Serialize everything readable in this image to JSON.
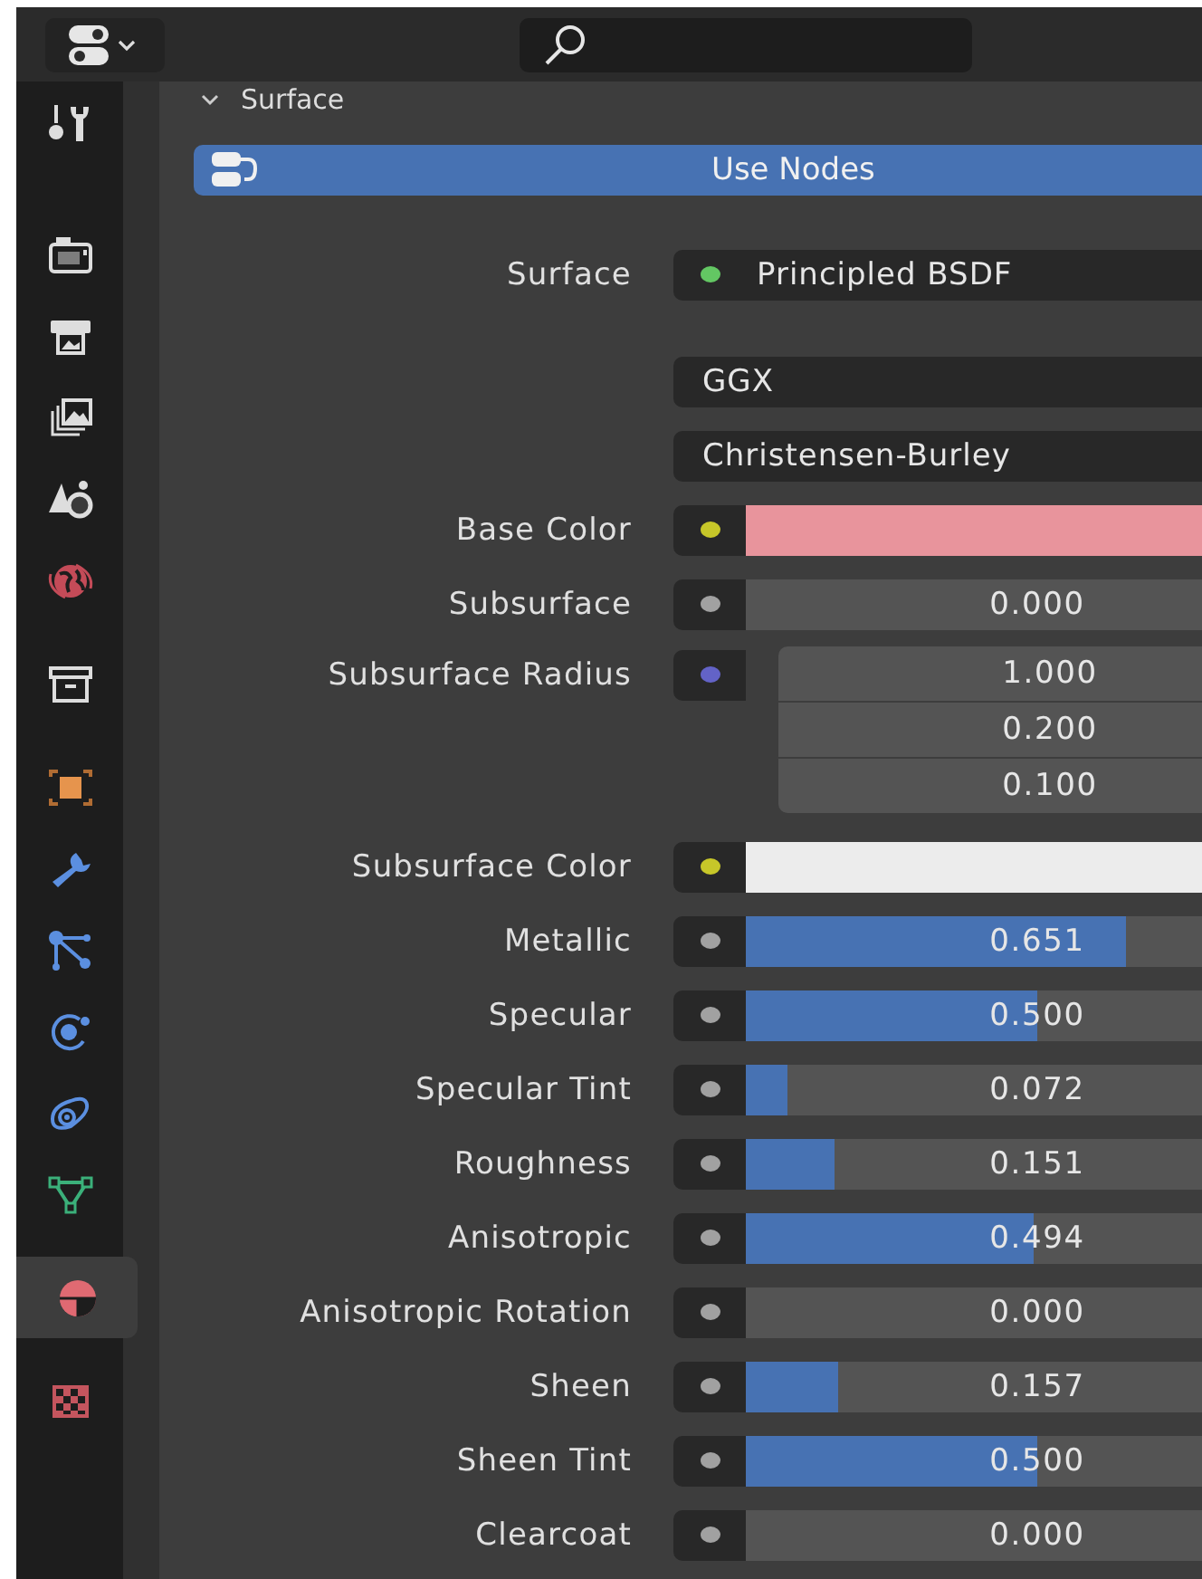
{
  "sidebar": {
    "groups": [
      {
        "tabs": [
          {
            "kind": "tool",
            "selected": false
          }
        ]
      },
      {
        "tabs": [
          {
            "kind": "render",
            "selected": false
          },
          {
            "kind": "output",
            "selected": false
          },
          {
            "kind": "view-layer",
            "selected": false
          },
          {
            "kind": "scene",
            "selected": false
          },
          {
            "kind": "world",
            "selected": false
          }
        ]
      },
      {
        "tabs": [
          {
            "kind": "collection",
            "selected": false
          }
        ]
      },
      {
        "tabs": [
          {
            "kind": "object",
            "selected": false
          },
          {
            "kind": "modifier",
            "selected": false
          },
          {
            "kind": "particles",
            "selected": false
          },
          {
            "kind": "physics",
            "selected": false
          },
          {
            "kind": "constraints",
            "selected": false
          },
          {
            "kind": "data",
            "selected": false
          }
        ]
      },
      {
        "tabs": [
          {
            "kind": "material",
            "selected": true
          }
        ]
      },
      {
        "tabs": [
          {
            "kind": "texture",
            "selected": false
          }
        ]
      }
    ]
  },
  "panel": {
    "title": "Surface",
    "expanded": true,
    "use_nodes": {
      "label": "Use Nodes",
      "on": true
    },
    "rows": [
      {
        "kind": "shader",
        "label": "Surface",
        "color": "#63c763",
        "value": "Principled BSDF"
      },
      {
        "kind": "dropdown",
        "value": "GGX"
      },
      {
        "kind": "dropdown",
        "value": "Christensen-Burley"
      },
      {
        "kind": "color",
        "label": "Base Color",
        "color": "#c7c729",
        "swatch": {
          "color": "#e8949c"
        }
      },
      {
        "kind": "slider",
        "label": "Subsurface",
        "color": "#a1a1a1",
        "value": "0.000"
      },
      {
        "kind": "vector",
        "label": "Subsurface Radius",
        "color": "#6363c7",
        "values": [
          "1.000",
          "0.200",
          "0.100"
        ]
      },
      {
        "kind": "color",
        "label": "Subsurface Color",
        "color": "#c7c729",
        "swatch": {
          "color": "#ececec"
        }
      },
      {
        "kind": "slider",
        "label": "Metallic",
        "color": "#a1a1a1",
        "value": "0.651",
        "level": 0.651
      },
      {
        "kind": "slider",
        "label": "Specular",
        "color": "#a1a1a1",
        "value": "0.500",
        "level": 0.5
      },
      {
        "kind": "slider",
        "label": "Specular Tint",
        "color": "#a1a1a1",
        "value": "0.072",
        "level": 0.072
      },
      {
        "kind": "slider",
        "label": "Roughness",
        "color": "#a1a1a1",
        "value": "0.151",
        "level": 0.151
      },
      {
        "kind": "slider",
        "label": "Anisotropic",
        "color": "#a1a1a1",
        "value": "0.494",
        "level": 0.494
      },
      {
        "kind": "slider",
        "label": "Anisotropic Rotation",
        "color": "#a1a1a1",
        "value": "0.000"
      },
      {
        "kind": "slider",
        "label": "Sheen",
        "color": "#a1a1a1",
        "value": "0.157",
        "level": 0.157
      },
      {
        "kind": "slider",
        "label": "Sheen Tint",
        "color": "#a1a1a1",
        "value": "0.500",
        "level": 0.5
      },
      {
        "kind": "slider",
        "label": "Clearcoat",
        "color": "#a1a1a1",
        "value": "0.000"
      }
    ]
  }
}
